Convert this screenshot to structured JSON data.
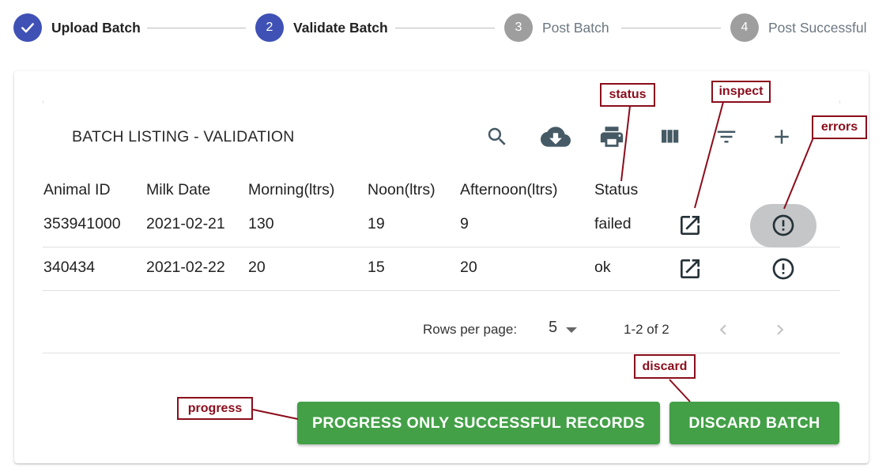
{
  "stepper": {
    "steps": [
      {
        "number": "1",
        "label": "Upload Batch",
        "state": "completed",
        "icon": "check-icon"
      },
      {
        "number": "2",
        "label": "Validate Batch",
        "state": "active"
      },
      {
        "number": "3",
        "label": "Post Batch",
        "state": "inactive"
      },
      {
        "number": "4",
        "label": "Post Successful",
        "state": "inactive"
      }
    ]
  },
  "table": {
    "title": "BATCH LISTING - VALIDATION",
    "toolbar_icons": [
      "search-icon",
      "cloud-download-icon",
      "print-icon",
      "view-column-icon",
      "filter-icon",
      "add-icon"
    ],
    "columns": [
      "Animal ID",
      "Milk Date",
      "Morning(ltrs)",
      "Noon(ltrs)",
      "Afternoon(ltrs)",
      "Status"
    ],
    "rows": [
      {
        "animal_id": "353941000",
        "milk_date": "2021-02-21",
        "morning": "130",
        "noon": "19",
        "afternoon": "9",
        "status": "failed"
      },
      {
        "animal_id": "340434",
        "milk_date": "2021-02-22",
        "morning": "20",
        "noon": "15",
        "afternoon": "20",
        "status": "ok"
      }
    ],
    "row_action_icons": [
      "open-in-new-icon",
      "error-outline-icon"
    ],
    "pagination": {
      "rows_per_page_label": "Rows per page:",
      "rows_per_page_value": "5",
      "range": "1-2 of 2"
    }
  },
  "actions": {
    "progress_label": "PROGRESS ONLY SUCCESSFUL RECORDS",
    "discard_label": "DISCARD BATCH"
  },
  "annotations": {
    "status": "status",
    "inspect": "inspect",
    "errors": "errors",
    "discard": "discard",
    "progress": "progress"
  },
  "colors": {
    "step_active": "#3f51b5",
    "step_inactive": "#9e9e9e",
    "button_green": "#43a047",
    "annotation": "#8b0d1c",
    "icon": "#455a64"
  }
}
